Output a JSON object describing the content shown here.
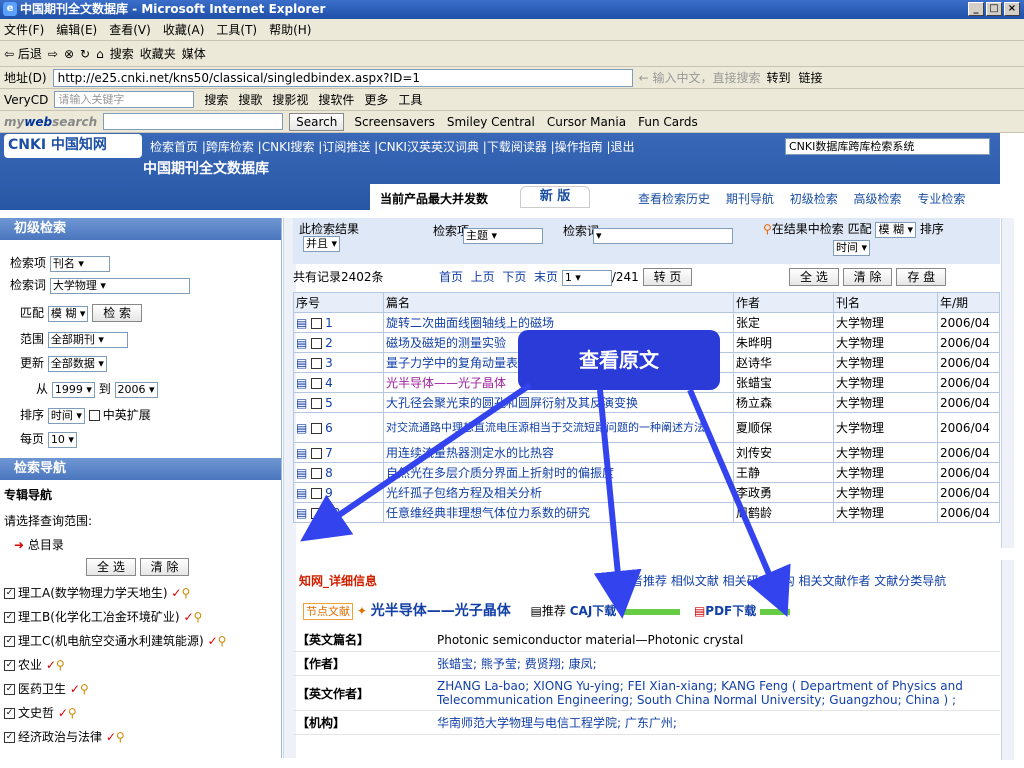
{
  "window": {
    "title": "中国期刊全文数据库 - Microsoft Internet Explorer",
    "ie_icon": "e"
  },
  "menu": [
    "文件(F)",
    "编辑(E)",
    "查看(V)",
    "收藏(A)",
    "工具(T)",
    "帮助(H)"
  ],
  "std_toolbar": {
    "back": "⇦ 后退",
    "search": "搜索",
    "favorites": "收藏夹",
    "media": "媒体"
  },
  "address": {
    "label": "地址(D)",
    "url": "http://e25.cnki.net/kns50/classical/singledbindex.aspx?ID=1",
    "hint": "← 输入中文，直接搜索",
    "go": "转到",
    "links": "链接"
  },
  "verycd": {
    "brand": "VeryCD",
    "placeholder": "请输入关键字",
    "search": "搜索",
    "songs": "搜歌",
    "movies": "搜影视",
    "software": "搜软件",
    "more": "更多",
    "tools": "工具"
  },
  "mywebsearch": {
    "brand_my": "my",
    "brand_web": "web",
    "brand_search": "search",
    "search_btn": "Search",
    "items": [
      "Screensavers",
      "Smiley Central",
      "Cursor Mania",
      "Fun Cards"
    ]
  },
  "cnki": {
    "logo": "CNKI 中国知网",
    "url_small": "www.cnki.net",
    "db_name": "中国期刊全文数据库",
    "nav": "检索首页 |跨库检索 |CNKI搜索 |订阅推送 |CNKI汉英英汉词典 |下载阅读器 |操作指南 |退出",
    "db_select": "CNKI数据库跨库检索系统",
    "promo": "当前产品最大并发数",
    "new_tab": "新 版",
    "top_links": [
      "查看检索历史",
      "期刊导航",
      "初级检索",
      "高级检索",
      "专业检索"
    ]
  },
  "left": {
    "panel_title": "初级检索",
    "field_label": "检索项",
    "field_value": "刊名",
    "word_label": "检索词",
    "word_value": "大学物理",
    "match_label": "匹配",
    "match_value": "模 糊",
    "search_btn": "检 索",
    "range_label": "范围",
    "range_value": "全部期刊",
    "update_label": "更新",
    "update_value": "全部数据",
    "from_label": "从",
    "from_value": "1999",
    "to_label": "到",
    "to_value": "2006",
    "order_label": "排序",
    "order_value": "时间",
    "ce_ext": "中英扩展",
    "per_label": "每页",
    "per_value": "10",
    "nav_title": "检索导航",
    "subject_nav": "专辑导航",
    "choose": "请选择查询范围:",
    "total": "总目录",
    "select_all": "全 选",
    "clear": "清 除",
    "subjects": [
      "理工A(数学物理力学天地生)",
      "理工B(化学化工冶金环境矿业)",
      "理工C(机电航空交通水利建筑能源)",
      "农业",
      "医药卫生",
      "文史哲",
      "经济政治与法律"
    ]
  },
  "results": {
    "within": "此检索结果",
    "and": "并且",
    "item_label": "检索项",
    "item_value": "主题",
    "word_label": "检索词",
    "in_results": "在结果中检索",
    "match_label": "匹配",
    "match": "模 糊",
    "order": "排序",
    "order_value": "时间",
    "total": "共有记录2402条",
    "first": "首页",
    "prev": "上页",
    "next": "下页",
    "last": "末页",
    "page": "1",
    "pages": "/241",
    "goto": "转 页",
    "sel_all": "全 选",
    "clear": "清 除",
    "save": "存 盘",
    "headers": [
      "序号",
      "篇名",
      "作者",
      "刊名",
      "年/期"
    ],
    "rows": [
      {
        "n": "1",
        "title": "旋转二次曲面线圈轴线上的磁场",
        "author": "张定",
        "journal": "大学物理",
        "issue": "2006/04"
      },
      {
        "n": "2",
        "title": "磁场及磁矩的测量实验",
        "author": "朱晔明",
        "journal": "大学物理",
        "issue": "2006/04"
      },
      {
        "n": "3",
        "title": "量子力学中的复角动量表示",
        "author": "赵诗华",
        "journal": "大学物理",
        "issue": "2006/04"
      },
      {
        "n": "4",
        "title": "光半导体——光子晶体",
        "author": "张蜡宝",
        "journal": "大学物理",
        "issue": "2006/04"
      },
      {
        "n": "5",
        "title": "大孔径会聚光束的圆孔和圆屏衍射及其反演变换",
        "author": "杨立森",
        "journal": "大学物理",
        "issue": "2006/04"
      },
      {
        "n": "6",
        "title": "对交流通路中理想直流电压源相当于交流短路问题的一种阐述方法",
        "author": "夏顺保",
        "journal": "大学物理",
        "issue": "2006/04"
      },
      {
        "n": "7",
        "title": "用连续流量热器测定水的比热容",
        "author": "刘传安",
        "journal": "大学物理",
        "issue": "2006/04"
      },
      {
        "n": "8",
        "title": "自然光在多层介质分界面上折射时的偏振度",
        "author": "王静",
        "journal": "大学物理",
        "issue": "2006/04"
      },
      {
        "n": "9",
        "title": "光纤孤子包络方程及相关分析",
        "author": "李政勇",
        "journal": "大学物理",
        "issue": "2006/04"
      },
      {
        "n": "10",
        "title": "任意维经典非理想气体位力系数的研究",
        "author": "周鹤龄",
        "journal": "大学物理",
        "issue": "2006/04"
      }
    ]
  },
  "callout": "查看原文",
  "detail": {
    "section": "_详细信息",
    "links": "读者推荐 相似文献 相关研究机构 相关文献作者 文献分类导航",
    "title": "光半导体——光子晶体",
    "recommend": "推荐",
    "caj": "CAJ下载",
    "pdf": "PDF下载",
    "badge": "节点文献",
    "fields": [
      {
        "k": "【英文篇名】",
        "v": "Photonic semiconductor material—Photonic crystal"
      },
      {
        "k": "【作者】",
        "v": "张蜡宝; 熊予莹; 费贤翔; 康凤;"
      },
      {
        "k": "【英文作者】",
        "v": "ZHANG La-bao; XIONG Yu-ying; FEI Xian-xiang; KANG Feng ( Department of Physics and Telecommunication Engineering; South China Normal University; Guangzhou; China ) ;"
      },
      {
        "k": "【机构】",
        "v": "华南师范大学物理与电信工程学院; 广东广州;"
      }
    ]
  },
  "colors": {
    "accent": "#1b4fa3",
    "callout": "#2a3bd8",
    "arrow": "#3344ee"
  }
}
